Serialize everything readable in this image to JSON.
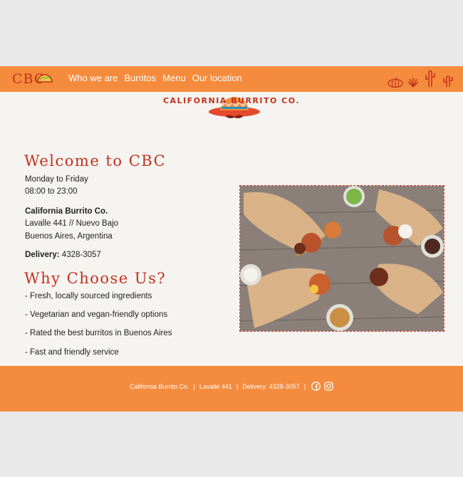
{
  "brand": {
    "logo_text": "CBC",
    "name": "CALIFORNIA BURRITO CO."
  },
  "nav": {
    "items": [
      "Who we are",
      "Burritos",
      "Menu",
      "Our location"
    ],
    "icons": [
      "pumpkin-icon",
      "agave-icon",
      "cactus-icon",
      "cactus-small-icon"
    ]
  },
  "welcome": {
    "title": "Welcome to CBC",
    "hours_days": "Monday to Friday",
    "hours_time": "08:00 to 23:00",
    "company": "California Burrito Co.",
    "address_1": "Lavalle 441 // Nuevo Bajo",
    "address_2": "Buenos Aires, Argentina",
    "delivery_label": "Delivery:",
    "delivery_phone": "4328-3057"
  },
  "why": {
    "title": "Why Choose Us?",
    "items": [
      "- Fresh, locally sourced ingredients",
      "- Vegetarian and vegan-friendly options",
      "- Rated the best burritos in Buenos Aires",
      "- Fast and friendly service"
    ]
  },
  "footer": {
    "company": "California Burrito Co.",
    "address": "Lavalle 441",
    "delivery": "Delivery: 4328-3057",
    "separator": "|",
    "social": [
      "facebook-icon",
      "instagram-icon"
    ]
  },
  "colors": {
    "accent_orange": "#f48b3d",
    "brand_red": "#c2311e",
    "page_bg": "#f6f4f1",
    "outer_bg": "#e9e9e9"
  }
}
